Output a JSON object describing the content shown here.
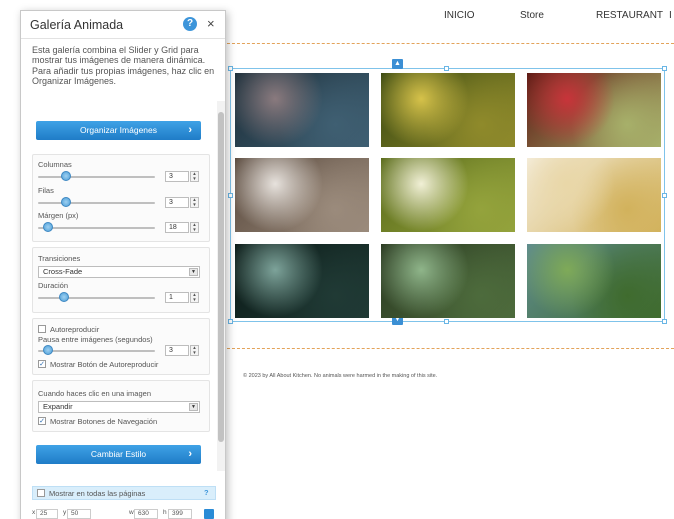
{
  "site": {
    "nav": [
      "INICIO",
      "Store",
      "RESTAURANT",
      "I"
    ],
    "footer": "© 2023 by All About Kitchen. No animals were harmed in the making of this site."
  },
  "gallery": {
    "tiles": [
      {
        "name": "dewdrops-photo",
        "colors": [
          "#1d2f3a",
          "#8a7a7e",
          "#3f5f72"
        ]
      },
      {
        "name": "yellow-foliage-photo",
        "colors": [
          "#3b4a12",
          "#d6c24a",
          "#8f8a2b"
        ]
      },
      {
        "name": "red-berries-photo",
        "colors": [
          "#5c1a14",
          "#c8343a",
          "#a7b06a"
        ]
      },
      {
        "name": "white-blossoms-photo",
        "colors": [
          "#5a4a3e",
          "#e7e2dd",
          "#9b8b7c"
        ]
      },
      {
        "name": "tree-sunlight-photo",
        "colors": [
          "#5a6b1b",
          "#f1f0d6",
          "#94a33c"
        ]
      },
      {
        "name": "flower-macro-photo",
        "colors": [
          "#f4ecd9",
          "#e9d7a8",
          "#d2b25c"
        ]
      },
      {
        "name": "leaf-pattern-photo",
        "colors": [
          "#0b1a17",
          "#7da39a",
          "#203a35"
        ]
      },
      {
        "name": "forest-photo",
        "colors": [
          "#2b3a22",
          "#8fb58a",
          "#4d6b3c"
        ]
      },
      {
        "name": "lily-pond-photo",
        "colors": [
          "#5f8c8f",
          "#7faa58",
          "#3f6b2e"
        ]
      }
    ]
  },
  "panel": {
    "title": "Galería Animada",
    "description": "Esta galería combina el Slider y Grid para mostrar tus imágenes de manera dinámica. Para añadir tus propias imágenes, haz clic en Organizar Imágenes.",
    "organize_button": "Organizar Imágenes",
    "columns_label": "Columnas",
    "columns_value": "3",
    "rows_label": "Filas",
    "rows_value": "3",
    "margin_label": "Márgen (px)",
    "margin_value": "18",
    "transitions_label": "Transiciones",
    "transition_value": "Cross-Fade",
    "duration_label": "Duración",
    "duration_value": "1",
    "autoplay_label": "Autoreproducir",
    "autoplay_checked": false,
    "pause_label": "Pausa entre imágenes (segundos)",
    "pause_value": "3",
    "show_autoplay_label": "Mostrar Botón de Autoreproducir",
    "show_autoplay_checked": true,
    "click_label": "Cuando haces clic en una imagen",
    "click_value": "Expandir",
    "show_nav_label": "Mostrar Botones de Navegación",
    "show_nav_checked": true,
    "style_button": "Cambiar Estilo",
    "all_pages_label": "Mostrar en todas las páginas",
    "all_pages_help": "?",
    "x_label": "x",
    "x_value": "25",
    "y_label": "y",
    "y_value": "50",
    "w_label": "w",
    "w_value": "630",
    "h_label": "h",
    "h_value": "399",
    "help_glyph": "?",
    "close_glyph": "×",
    "chevron_glyph": "›"
  },
  "colors": {
    "accent": "#2a8bd6",
    "frame": "#7fc3ea",
    "dashed": "#e3a35a"
  }
}
